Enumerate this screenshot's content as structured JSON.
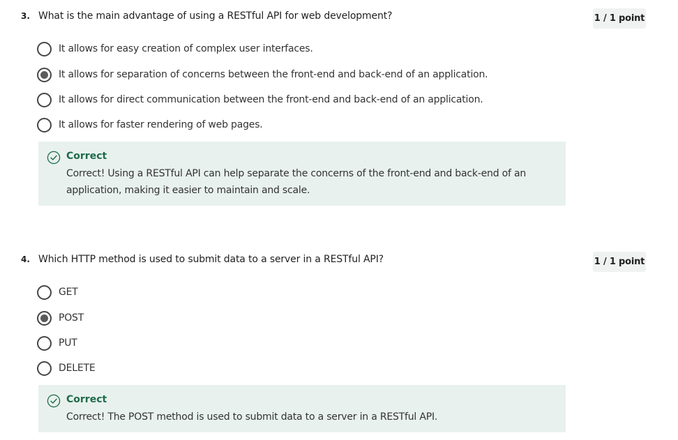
{
  "questions": [
    {
      "number": "3.",
      "text": "What is the main advantage of using a RESTful API for web development?",
      "points": "1 / 1 point",
      "options": [
        {
          "label": "It allows for easy creation of complex user interfaces.",
          "selected": false
        },
        {
          "label": "It allows for separation of concerns between the front-end and back-end of an application.",
          "selected": true
        },
        {
          "label": "It allows for direct communication between the front-end and back-end of an application.",
          "selected": false
        },
        {
          "label": "It allows for faster rendering of web pages.",
          "selected": false
        }
      ],
      "feedback": {
        "status": "Correct",
        "text": "Correct! Using a RESTful API can help separate the concerns of the front-end and back-end of an application, making it easier to maintain and scale."
      }
    },
    {
      "number": "4.",
      "text": "Which HTTP method is used to submit data to a server in a RESTful API?",
      "points": "1 / 1 point",
      "options": [
        {
          "label": "GET",
          "selected": false
        },
        {
          "label": "POST",
          "selected": true
        },
        {
          "label": "PUT",
          "selected": false
        },
        {
          "label": "DELETE",
          "selected": false
        }
      ],
      "feedback": {
        "status": "Correct",
        "text": "Correct! The POST method is used to submit data to a server in a RESTful API."
      }
    }
  ],
  "colors": {
    "correct_green": "#1e6b4b",
    "feedback_background": "#e8f1ee",
    "badge_background": "#f0f1f1"
  },
  "icons": {
    "feedback": "check-circle-icon",
    "selected_option": "radio-selected-icon",
    "unselected_option": "radio-unselected-icon"
  }
}
